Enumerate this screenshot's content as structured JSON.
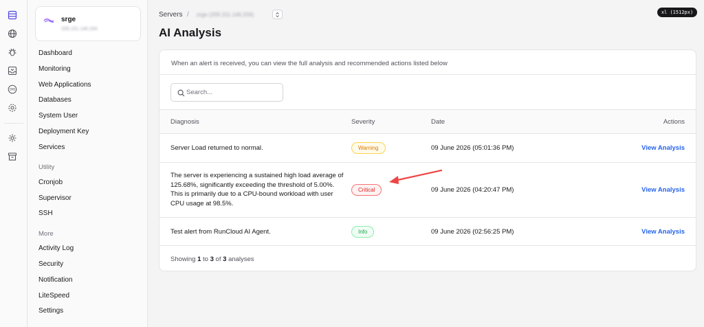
{
  "rail": {
    "icons": [
      "servers-icon",
      "globe-icon",
      "bug-icon",
      "inbox-icon",
      "dns-icon",
      "settings-cog-icon",
      "gear-icon",
      "archive-icon"
    ]
  },
  "sidebar": {
    "server": {
      "name": "srge",
      "ip": "209.151.146.204"
    },
    "items": [
      {
        "label": "Dashboard"
      },
      {
        "label": "Monitoring"
      },
      {
        "label": "Web Applications"
      },
      {
        "label": "Databases"
      },
      {
        "label": "System User"
      },
      {
        "label": "Deployment Key"
      },
      {
        "label": "Services"
      }
    ],
    "utility_heading": "Utility",
    "utility_items": [
      {
        "label": "Cronjob"
      },
      {
        "label": "Supervisor"
      },
      {
        "label": "SSH"
      }
    ],
    "more_heading": "More",
    "more_items": [
      {
        "label": "Activity Log"
      },
      {
        "label": "Security"
      },
      {
        "label": "Notification"
      },
      {
        "label": "LiteSpeed"
      },
      {
        "label": "Settings"
      }
    ]
  },
  "breadcrumb": {
    "root": "Servers",
    "separator": "/",
    "current": "srge (209.151.146.204)"
  },
  "page": {
    "title": "AI Analysis",
    "badge": "xl (1512px)",
    "description": "When an alert is received, you can view the full analysis and recommended actions listed below"
  },
  "search": {
    "placeholder": "Search..."
  },
  "table": {
    "headers": {
      "diagnosis": "Diagnosis",
      "severity": "Severity",
      "date": "Date",
      "actions": "Actions"
    },
    "rows": [
      {
        "diagnosis": "Server Load returned to normal.",
        "severity": "Warning",
        "date": "09 June 2026 (05:01:36 PM)",
        "action": "View Analysis"
      },
      {
        "diagnosis": "The server is experiencing a sustained high load average of 125.68%, significantly exceeding the threshold of 5.00%. This is primarily due to a CPU-bound workload with user CPU usage at 98.5%.",
        "severity": "Critical",
        "date": "09 June 2026 (04:20:47 PM)",
        "action": "View Analysis"
      },
      {
        "diagnosis": "Test alert from RunCloud AI Agent.",
        "severity": "Info",
        "date": "09 June 2026 (02:56:25 PM)",
        "action": "View Analysis"
      }
    ],
    "footer": {
      "prefix": "Showing",
      "from": "1",
      "to_word": "to",
      "to": "3",
      "of_word": "of",
      "total": "3",
      "suffix": "analyses"
    }
  },
  "colors": {
    "accent_link": "#2563eb",
    "warning": "#d97706",
    "critical": "#dc2626",
    "info": "#16a34a",
    "annotation_arrow": "#ef4444"
  }
}
